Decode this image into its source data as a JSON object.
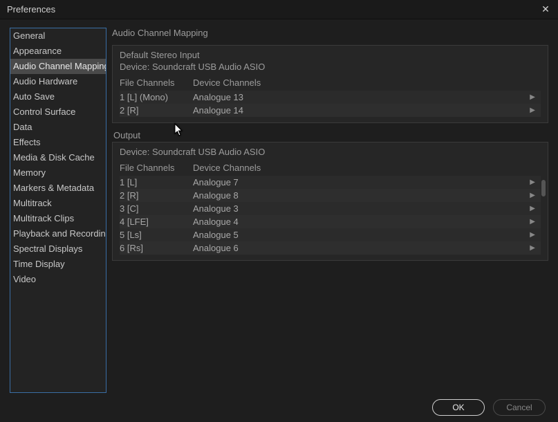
{
  "window": {
    "title": "Preferences"
  },
  "sidebar": {
    "items": [
      "General",
      "Appearance",
      "Audio Channel Mapping",
      "Audio Hardware",
      "Auto Save",
      "Control Surface",
      "Data",
      "Effects",
      "Media & Disk Cache",
      "Memory",
      "Markers & Metadata",
      "Multitrack",
      "Multitrack Clips",
      "Playback and Recording",
      "Spectral Displays",
      "Time Display",
      "Video"
    ],
    "selectedIndex": 2
  },
  "content": {
    "title": "Audio Channel Mapping",
    "input": {
      "title": "Default Stereo Input",
      "device_label": "Device:",
      "device_name": "Soundcraft USB Audio ASIO",
      "headers": {
        "file": "File Channels",
        "device": "Device Channels"
      },
      "rows": [
        {
          "file": "1 [L] (Mono)",
          "device": "Analogue 13"
        },
        {
          "file": "2 [R]",
          "device": "Analogue 14"
        }
      ]
    },
    "output": {
      "title": "Output",
      "device_label": "Device:",
      "device_name": "Soundcraft USB Audio ASIO",
      "headers": {
        "file": "File Channels",
        "device": "Device Channels"
      },
      "rows": [
        {
          "file": "1 [L]",
          "device": "Analogue 7"
        },
        {
          "file": "2 [R]",
          "device": "Analogue 8"
        },
        {
          "file": "3 [C]",
          "device": "Analogue 3"
        },
        {
          "file": "4 [LFE]",
          "device": "Analogue 4"
        },
        {
          "file": "5 [Ls]",
          "device": "Analogue 5"
        },
        {
          "file": "6 [Rs]",
          "device": "Analogue 6"
        }
      ]
    }
  },
  "footer": {
    "ok": "OK",
    "cancel": "Cancel"
  }
}
